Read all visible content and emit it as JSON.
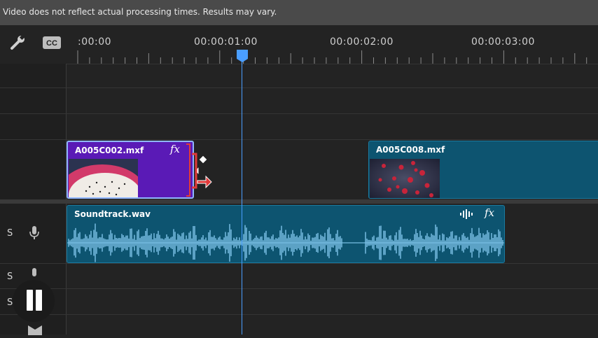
{
  "notice": {
    "text": "Video does not reflect actual processing times. Results may vary."
  },
  "toolbar": {
    "tools": [
      {
        "icon": "wrench-icon"
      },
      {
        "icon": "closed-captions-icon",
        "text": "CC"
      }
    ]
  },
  "ruler": {
    "timecodes": [
      ":00:00",
      "00:00:01:00",
      "00:00:02:00",
      "00:00:03:00"
    ]
  },
  "playhead": {
    "timecode": "00:00:01:00",
    "color": "#4a9eff"
  },
  "tracks": {
    "headers": [
      {
        "label": "S",
        "icon": "microphone-icon"
      },
      {
        "label": "S",
        "icon": "microphone-icon"
      },
      {
        "label": "S",
        "icon": "microphone-icon"
      }
    ]
  },
  "clips": {
    "video1": {
      "name": "A005C002.mxf",
      "fx": "fx",
      "color": "#5a1ab6",
      "state": "selected-trimming"
    },
    "video2": {
      "name": "A005C008.mxf",
      "color": "#0d5470"
    },
    "audio1": {
      "name": "Soundtrack.wav",
      "fx": "fx",
      "color": "#0d5470"
    }
  },
  "transport": {
    "state": "playing",
    "icon": "pause-icon"
  },
  "colors": {
    "accent": "#4a9eff",
    "trim_handle": "#e03a3a"
  }
}
